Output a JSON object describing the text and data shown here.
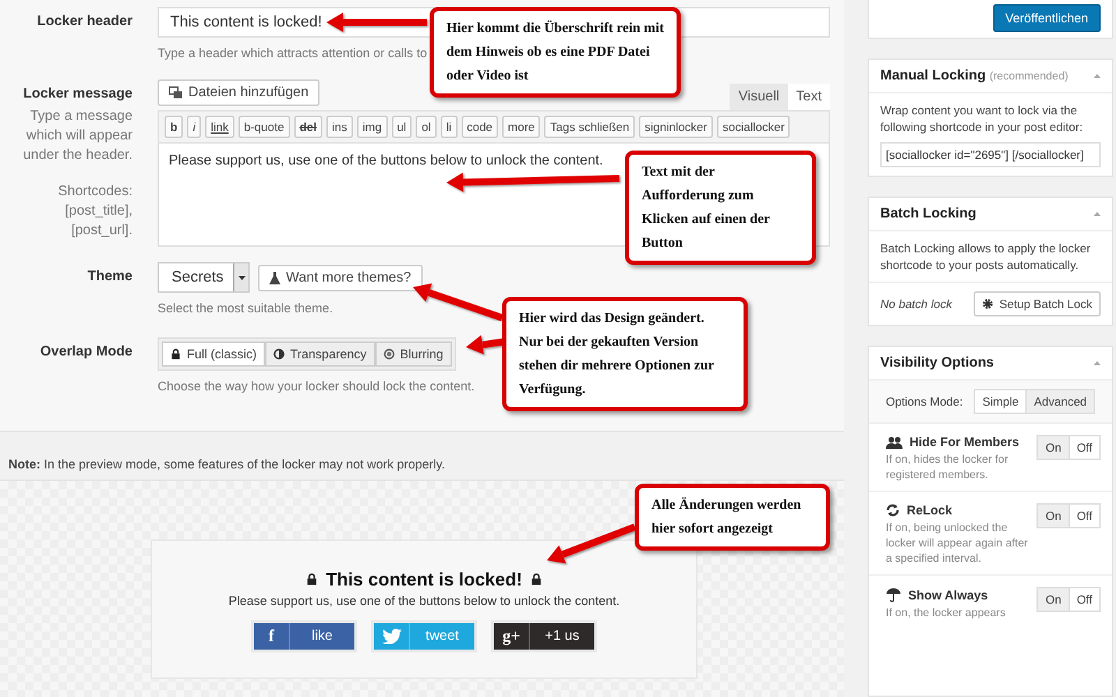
{
  "form": {
    "fields": [
      {
        "kind": "text",
        "label": "Locker header",
        "value": "This content is locked!",
        "hint": "Type a header which attracts attention or calls to"
      },
      {
        "kind": "editor",
        "label": "Locker message",
        "description": "Type a message which will appear under the header.",
        "shortcodes": "Shortcodes: [post_title], [post_url].",
        "media_button": "Dateien hinzufügen",
        "tabs": [
          {
            "label": "Visuell",
            "selected": false
          },
          {
            "label": "Text",
            "selected": true
          }
        ],
        "toolbar": [
          {
            "kind": "bold",
            "label": "b"
          },
          {
            "kind": "italic",
            "label": "i"
          },
          {
            "kind": "link",
            "label": "link"
          },
          {
            "kind": "plain",
            "label": "b-quote"
          },
          {
            "kind": "strike",
            "label": "del"
          },
          {
            "kind": "plain",
            "label": "ins"
          },
          {
            "kind": "plain",
            "label": "img"
          },
          {
            "kind": "plain",
            "label": "ul"
          },
          {
            "kind": "plain",
            "label": "ol"
          },
          {
            "kind": "plain",
            "label": "li"
          },
          {
            "kind": "plain",
            "label": "code"
          },
          {
            "kind": "plain",
            "label": "more"
          },
          {
            "kind": "plain",
            "label": "Tags schließen"
          },
          {
            "kind": "plain",
            "label": "signinlocker"
          },
          {
            "kind": "plain",
            "label": "sociallocker"
          }
        ],
        "value": "Please support us, use one of the buttons below to unlock the content."
      },
      {
        "kind": "select",
        "label": "Theme",
        "value": "Secrets",
        "extra_button": "Want more themes?",
        "hint": "Select the most suitable theme."
      },
      {
        "kind": "segmented",
        "label": "Overlap Mode",
        "options": [
          {
            "label": "Full (classic)",
            "selected": true
          },
          {
            "label": "Transparency",
            "selected": false
          },
          {
            "label": "Blurring",
            "selected": false
          }
        ],
        "hint": "Choose the way how your locker should lock the content."
      }
    ]
  },
  "note": "**Note:** In the preview mode, some features of the locker may not work properly.",
  "preview": {
    "title": "This content is locked!",
    "message": "Please support us, use one of the buttons below to unlock the content.",
    "buttons": [
      {
        "kind": "facebook",
        "glyph": "f",
        "label": "like"
      },
      {
        "kind": "twitter",
        "label": "tweet"
      },
      {
        "kind": "google",
        "glyph": "g+",
        "label": "+1 us"
      }
    ]
  },
  "sidebar": {
    "publish_button": "Veröffentlichen",
    "manual_locking": {
      "title": "Manual Locking",
      "subtitle": "(recommended)",
      "text": "Wrap content you want to lock via the following shortcode in your post editor:",
      "shortcode": "[sociallocker id=\"2695\"] [/sociallocker]"
    },
    "batch_locking": {
      "title": "Batch Locking",
      "text": "Batch Locking allows to apply the locker shortcode to your posts automatically.",
      "status": "No batch lock",
      "button": "Setup Batch Lock"
    },
    "visibility": {
      "title": "Visibility Options",
      "mode_label": "Options Mode:",
      "modes": [
        {
          "label": "Simple",
          "selected": true
        },
        {
          "label": "Advanced",
          "selected": false
        }
      ],
      "items": [
        {
          "kind": "members",
          "title": "Hide For Members",
          "text": "If on, hides the locker for registered members.",
          "options": [
            {
              "label": "On",
              "selected": false
            },
            {
              "label": "Off",
              "selected": true
            }
          ]
        },
        {
          "kind": "relock",
          "title": "ReLock",
          "text": "If on, being unlocked the locker will appear again after a specified interval.",
          "options": [
            {
              "label": "On",
              "selected": false
            },
            {
              "label": "Off",
              "selected": true
            }
          ]
        },
        {
          "kind": "always",
          "title": "Show Always",
          "text": "If on, the locker appears",
          "options": [
            {
              "label": "On",
              "selected": false
            },
            {
              "label": "Off",
              "selected": true
            }
          ]
        }
      ]
    }
  },
  "callouts": [
    {
      "text": "Hier kommt die Überschrift rein mit dem Hinweis ob es eine PDF Datei oder Video ist"
    },
    {
      "text": "Text mit der Aufforderung zum Klicken auf einen der Button"
    },
    {
      "text": "Hier wird das Design geändert. Nur bei der gekauften Version stehen dir mehrere Optionen zur Verfügung."
    },
    {
      "text": "Alle Änderungen werden hier sofort angezeigt"
    }
  ]
}
